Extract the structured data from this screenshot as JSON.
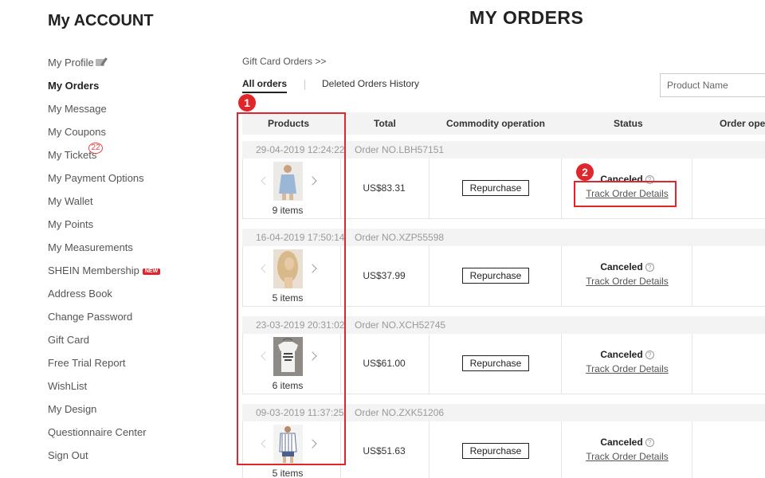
{
  "sidebar": {
    "title": "My ACCOUNT",
    "items": [
      {
        "label": "My Profile"
      },
      {
        "label": "My Orders"
      },
      {
        "label": "My Message"
      },
      {
        "label": "My Coupons"
      },
      {
        "label": "My Tickets",
        "badge": "22"
      },
      {
        "label": "My Payment Options"
      },
      {
        "label": "My Wallet"
      },
      {
        "label": "My Points"
      },
      {
        "label": "My Measurements"
      },
      {
        "label": "SHEIN Membership",
        "badge": "NEW"
      },
      {
        "label": "Address Book"
      },
      {
        "label": "Change Password"
      },
      {
        "label": "Gift Card"
      },
      {
        "label": "Free Trial Report"
      },
      {
        "label": "WishList"
      },
      {
        "label": "My Design"
      },
      {
        "label": "Questionnaire Center"
      },
      {
        "label": "Sign Out"
      }
    ]
  },
  "main": {
    "title": "MY ORDERS",
    "breadcrumb": "Gift Card Orders >>",
    "tabs": [
      {
        "label": "All orders"
      },
      {
        "label": "Deleted Orders History"
      }
    ],
    "search": {
      "placeholder": "Product Name"
    },
    "table": {
      "headers": [
        "Products",
        "Total",
        "Commodity operation",
        "Status",
        "Order ope"
      ]
    },
    "orders": [
      {
        "date": "29-04-2019 12:24:22",
        "order_no": "Order NO.LBH57151",
        "items": "9 items",
        "total": "US$83.31",
        "action": "Repurchase",
        "status": "Canceled",
        "help": "?",
        "link": "Track Order Details"
      },
      {
        "date": "16-04-2019 17:50:14",
        "order_no": "Order NO.XZP55598",
        "items": "5 items",
        "total": "US$37.99",
        "action": "Repurchase",
        "status": "Canceled",
        "help": "?",
        "link": "Track Order Details"
      },
      {
        "date": "23-03-2019 20:31:02",
        "order_no": "Order NO.XCH52745",
        "items": "6 items",
        "total": "US$61.00",
        "action": "Repurchase",
        "status": "Canceled",
        "help": "?",
        "link": "Track Order Details"
      },
      {
        "date": "09-03-2019 11:37:25",
        "order_no": "Order NO.ZXK51206",
        "items": "5 items",
        "total": "US$51.63",
        "action": "Repurchase",
        "status": "Canceled",
        "help": "?",
        "link": "Track Order Details"
      }
    ]
  },
  "annotations": [
    {
      "number": "1"
    },
    {
      "number": "2"
    }
  ],
  "colors": {
    "accent": "#e0262b",
    "header_bg": "#f3f3f3"
  }
}
